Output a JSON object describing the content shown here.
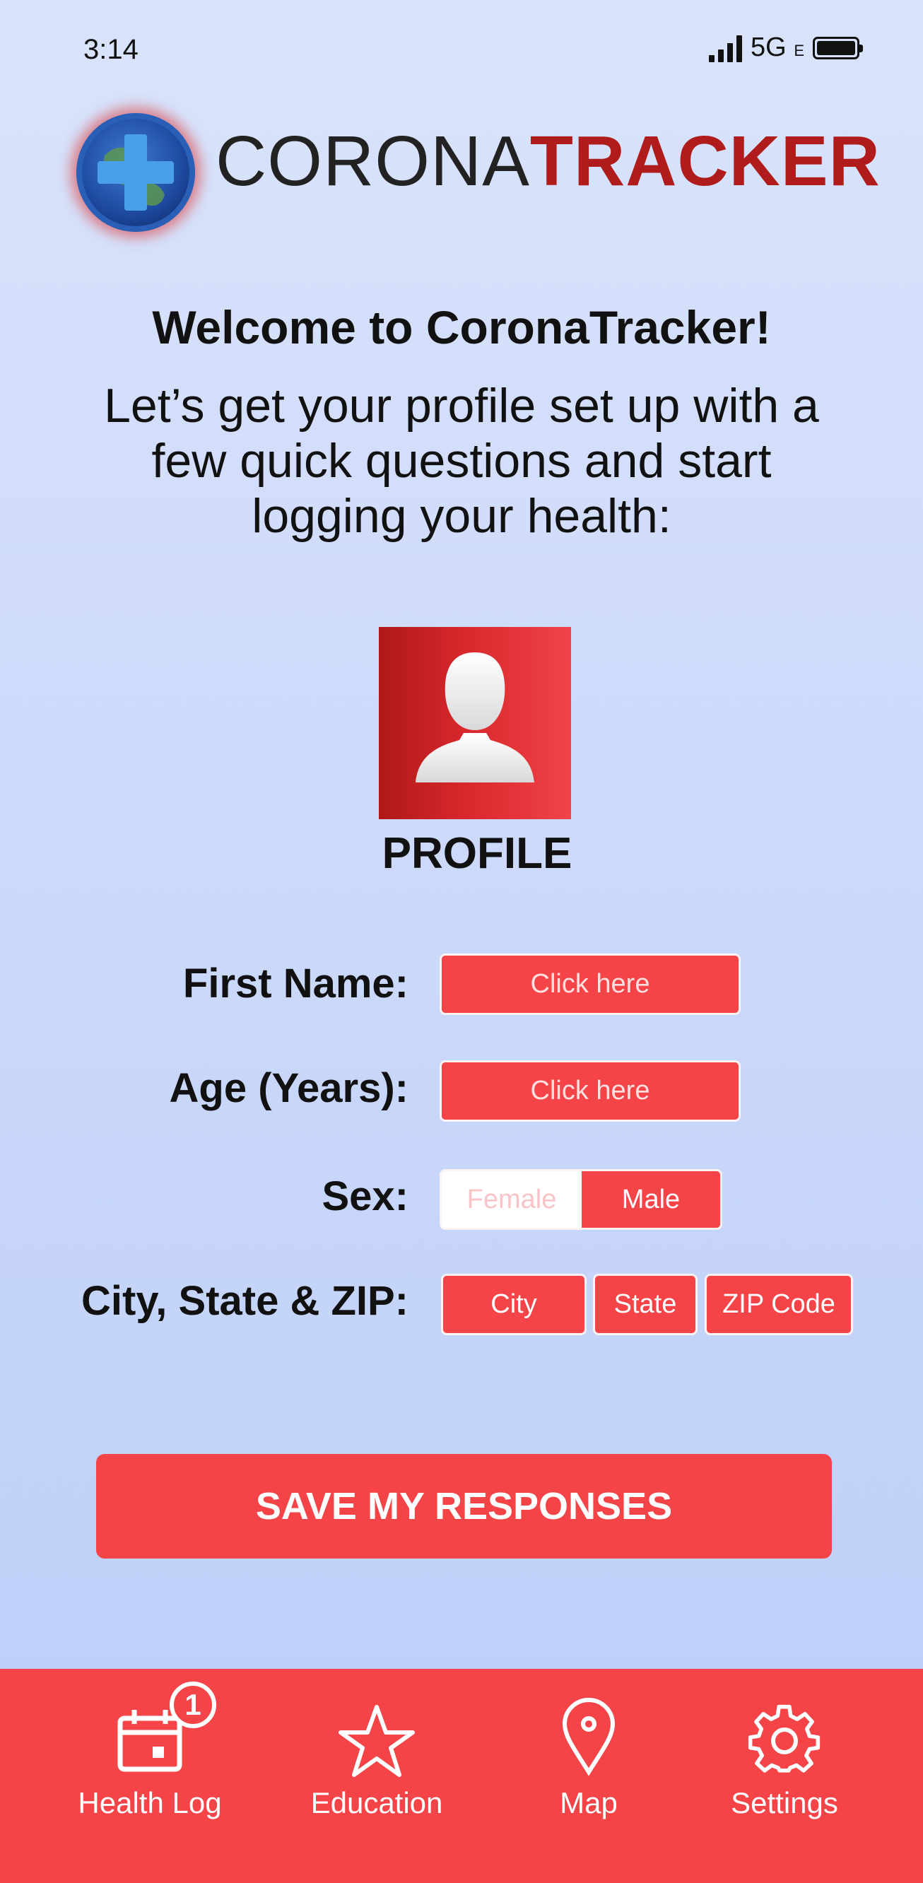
{
  "status_bar": {
    "time": "3:14",
    "network": "5G",
    "network_sub": "E"
  },
  "logo": {
    "part1": "CORONA",
    "part2": "TRACKER"
  },
  "welcome": "Welcome to CoronaTracker!",
  "intro": "Let’s get your profile set up with a few quick questions and start logging your health:",
  "profile": {
    "label": "PROFILE"
  },
  "form": {
    "first_name": {
      "label": "First Name:",
      "placeholder": "Click here"
    },
    "age": {
      "label": "Age (Years):",
      "placeholder": "Click here"
    },
    "sex": {
      "label": "Sex:",
      "options": [
        "Female",
        "Male"
      ],
      "selected": "Male"
    },
    "location": {
      "label": "City, State & ZIP:",
      "city": "City",
      "state": "State",
      "zip": "ZIP Code"
    }
  },
  "save_button": "SAVE MY RESPONSES",
  "tabs": [
    {
      "label": "Health Log",
      "icon": "calendar-icon",
      "badge": "1"
    },
    {
      "label": "Education",
      "icon": "star-icon"
    },
    {
      "label": "Map",
      "icon": "map-pin-icon"
    },
    {
      "label": "Settings",
      "icon": "gear-icon"
    }
  ],
  "colors": {
    "accent": "#f54448",
    "brand_dark": "#b01c1c"
  }
}
